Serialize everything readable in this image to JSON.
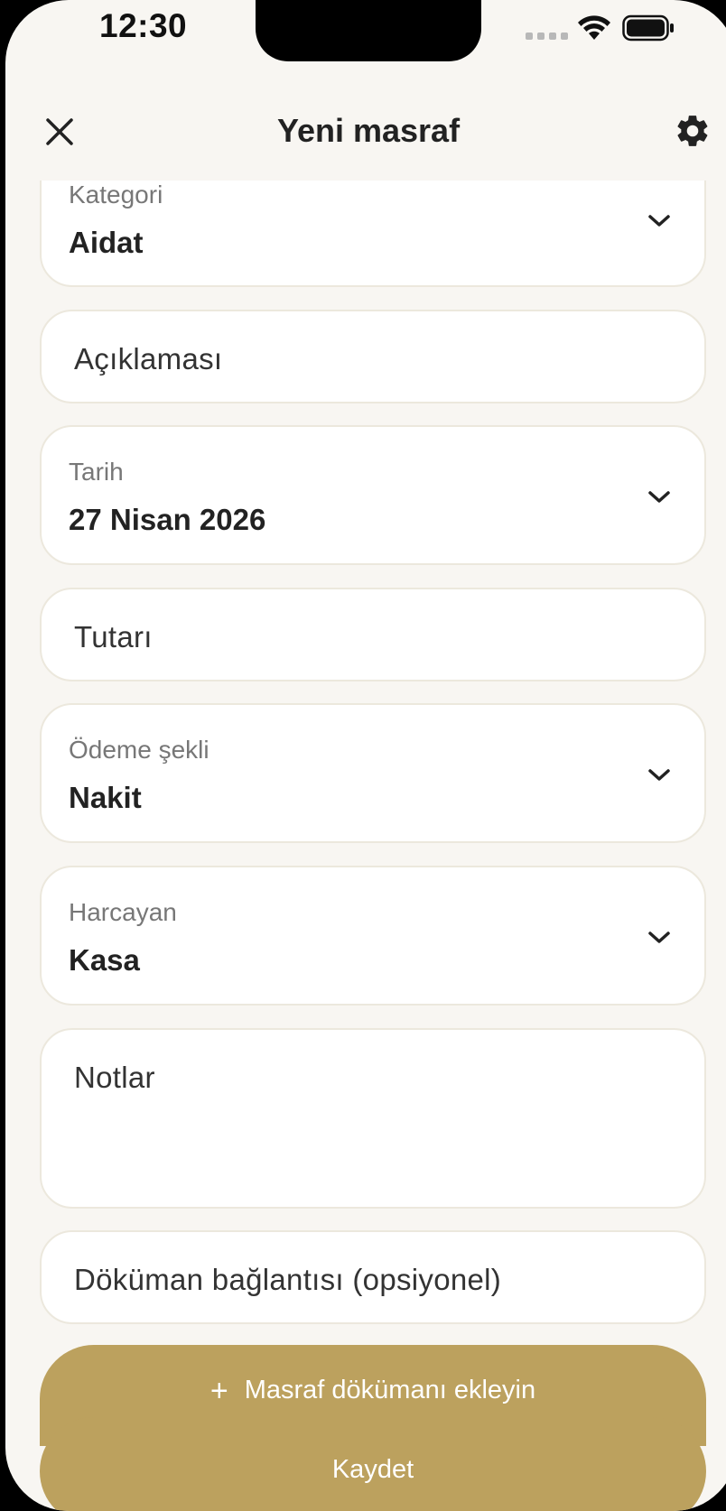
{
  "status_bar": {
    "time": "12:30"
  },
  "header": {
    "title": "Yeni masraf"
  },
  "form": {
    "category": {
      "label": "Kategori",
      "value": "Aidat"
    },
    "description": {
      "placeholder": "Açıklaması"
    },
    "date": {
      "label": "Tarih",
      "value": "27 Nisan 2026"
    },
    "amount": {
      "placeholder": "Tutarı"
    },
    "payment_method": {
      "label": "Ödeme şekli",
      "value": "Nakit"
    },
    "spender": {
      "label": "Harcayan",
      "value": "Kasa"
    },
    "notes": {
      "placeholder": "Notlar"
    },
    "document_link": {
      "placeholder": "Döküman bağlantısı (opsiyonel)"
    }
  },
  "buttons": {
    "add_document": "Masraf dökümanı ekleyin",
    "add_document_icon": "plus-icon",
    "save": "Kaydet"
  },
  "colors": {
    "accent": "#bca15e",
    "background": "#f8f6f2",
    "card": "#ffffff",
    "border": "#ece8dd"
  }
}
